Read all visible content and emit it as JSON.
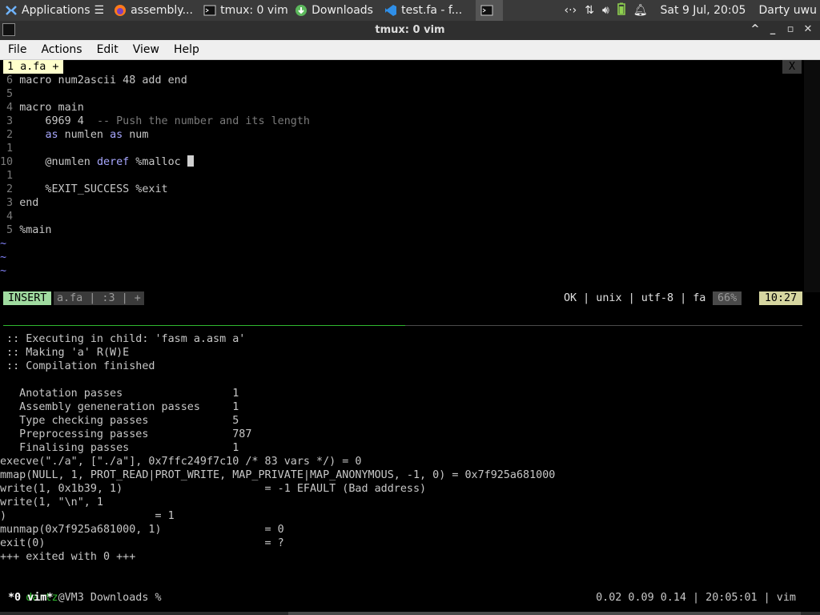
{
  "panel": {
    "tasks": [
      {
        "label": "Applications",
        "icon": "xfce-mouse-icon"
      },
      {
        "label": "assembly...",
        "icon": "firefox-icon"
      },
      {
        "label": "tmux: 0 vim",
        "icon": "terminal-icon"
      },
      {
        "label": "Downloads",
        "icon": "download-icon"
      },
      {
        "label": "test.fa - f...",
        "icon": "vscode-icon"
      }
    ],
    "clock": "Sat  9 Jul, 20:05",
    "user": "Darty uwu"
  },
  "window": {
    "title": "tmux: 0 vim"
  },
  "menu": [
    "File",
    "Actions",
    "Edit",
    "View",
    "Help"
  ],
  "vim": {
    "tab_label": "1 a.fa +",
    "tab_close": "X",
    "lines": [
      {
        "num": " 6",
        "parts": [
          {
            "t": "macro num2ascii 48 add end"
          }
        ]
      },
      {
        "num": " 5",
        "parts": []
      },
      {
        "num": " 4",
        "parts": [
          {
            "t": "macro main"
          }
        ]
      },
      {
        "num": " 3",
        "parts": [
          {
            "t": "    6969 4  "
          },
          {
            "t": "-- Push the number and its length",
            "c": "cm"
          }
        ]
      },
      {
        "num": " 2",
        "parts": [
          {
            "t": "    "
          },
          {
            "t": "as",
            "c": "kw"
          },
          {
            "t": " numlen "
          },
          {
            "t": "as",
            "c": "kw"
          },
          {
            "t": " num"
          }
        ]
      },
      {
        "num": " 1",
        "parts": []
      },
      {
        "num": "10",
        "parts": [
          {
            "t": "    @numlen "
          },
          {
            "t": "deref",
            "c": "kw"
          },
          {
            "t": " %malloc "
          }
        ],
        "cursor": true
      },
      {
        "num": " 1",
        "parts": []
      },
      {
        "num": " 2",
        "parts": [
          {
            "t": "    %EXIT_SUCCESS %exit"
          }
        ]
      },
      {
        "num": " 3",
        "parts": [
          {
            "t": "end"
          }
        ]
      },
      {
        "num": " 4",
        "parts": []
      },
      {
        "num": " 5",
        "parts": [
          {
            "t": "%main"
          }
        ]
      }
    ],
    "tildes": [
      "~",
      "~",
      "~"
    ],
    "status": {
      "mode": "INSERT",
      "file": "a.fa | :3 | +",
      "info": "OK | unix | utf-8 | fa",
      "percent": "66%",
      "position": "10:27"
    }
  },
  "output": [
    " :: Executing in child: 'fasm a.asm a'",
    " :: Making 'a' R(W)E",
    " :: Compilation finished",
    "",
    "   Anotation passes                 1",
    "   Assembly geneneration passes     1",
    "   Type checking passes             5",
    "   Preprocessing passes             787",
    "   Finalising passes                1",
    "execve(\"./a\", [\"./a\"], 0x7ffc249f7c10 /* 83 vars */) = 0",
    "mmap(NULL, 1, PROT_READ|PROT_WRITE, MAP_PRIVATE|MAP_ANONYMOUS, -1, 0) = 0x7f925a681000",
    "write(1, 0x1b39, 1)                      = -1 EFAULT (Bad address)",
    "write(1, \"\\n\", 1",
    ")                       = 1",
    "munmap(0x7f925a681000, 1)                = 0",
    "exit(0)                                  = ?",
    "+++ exited with 0 +++",
    ""
  ],
  "prompt": {
    "user": "dartz",
    "rest": "@VM3 Downloads % "
  },
  "tmux": {
    "window": "*0 vim*",
    "right": "0.02 0.09 0.14 | 20:05:01 | vim"
  }
}
